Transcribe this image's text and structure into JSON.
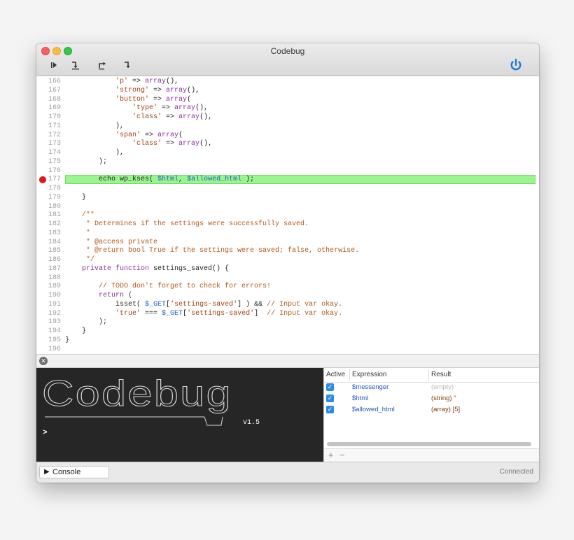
{
  "window": {
    "title": "Codebug"
  },
  "toolbar": {
    "buttons": [
      {
        "name": "continue-button",
        "icon": "continue-icon",
        "glyph": "⏵"
      },
      {
        "name": "step-over-button",
        "icon": "step-over-icon",
        "glyph": "↴"
      },
      {
        "name": "step-out-button",
        "icon": "step-out-icon",
        "glyph": "↱"
      },
      {
        "name": "step-into-button",
        "icon": "step-into-icon",
        "glyph": "↳"
      }
    ],
    "power_icon": "power-icon",
    "power_color": "#1f7bd8"
  },
  "editor": {
    "highlight_color": "#9af58f",
    "breakpoint_color": "#e4141b",
    "lines": [
      {
        "n": "166",
        "html": "            <span class=\"str\">'p'</span> => <span class=\"kw\">array</span>(),"
      },
      {
        "n": "167",
        "html": "            <span class=\"str\">'strong'</span> => <span class=\"kw\">array</span>(),"
      },
      {
        "n": "168",
        "html": "            <span class=\"str\">'button'</span> => <span class=\"kw\">array</span>("
      },
      {
        "n": "169",
        "html": "                <span class=\"str\">'type'</span> => <span class=\"kw\">array</span>(),"
      },
      {
        "n": "170",
        "html": "                <span class=\"str\">'class'</span> => <span class=\"kw\">array</span>(),"
      },
      {
        "n": "171",
        "html": "            ),"
      },
      {
        "n": "172",
        "html": "            <span class=\"str\">'span'</span> => <span class=\"kw\">array</span>("
      },
      {
        "n": "173",
        "html": "                <span class=\"str\">'class'</span> => <span class=\"kw\">array</span>(),"
      },
      {
        "n": "174",
        "html": "            ),"
      },
      {
        "n": "175",
        "html": "        );"
      },
      {
        "n": "176",
        "html": ""
      },
      {
        "n": "177",
        "html": "        echo wp_kses( <span class=\"var\">$html</span>, <span class=\"var\">$allowed_html</span> );",
        "highlight": true,
        "breakpoint": true
      },
      {
        "n": "178",
        "html": ""
      },
      {
        "n": "179",
        "html": "    }"
      },
      {
        "n": "180",
        "html": ""
      },
      {
        "n": "181",
        "html": "    <span class=\"cmt\">/**</span>"
      },
      {
        "n": "182",
        "html": "<span class=\"cmt\">     * Determines if the settings were successfully saved.</span>"
      },
      {
        "n": "183",
        "html": "<span class=\"cmt\">     *</span>"
      },
      {
        "n": "184",
        "html": "<span class=\"cmt\">     * @access private</span>"
      },
      {
        "n": "185",
        "html": "<span class=\"cmt\">     * @return bool True if the settings were saved; false, otherwise.</span>"
      },
      {
        "n": "186",
        "html": "<span class=\"cmt\">     */</span>"
      },
      {
        "n": "187",
        "html": "    <span class=\"kw\">private function</span> settings_saved() {"
      },
      {
        "n": "188",
        "html": ""
      },
      {
        "n": "189",
        "html": "        <span class=\"cmt\">// TODO don't forget to check for errors!</span>"
      },
      {
        "n": "190",
        "html": "        <span class=\"kw\">return</span> ("
      },
      {
        "n": "191",
        "html": "            isset( <span class=\"var\">$_GET</span>[<span class=\"str\">'settings-saved'</span>] ) && <span class=\"cmt\">// Input var okay.</span>"
      },
      {
        "n": "192",
        "html": "            <span class=\"str\">'true'</span> === <span class=\"var\">$_GET</span>[<span class=\"str\">'settings-saved'</span>]  <span class=\"cmt\">// Input var okay.</span>"
      },
      {
        "n": "193",
        "html": "        );"
      },
      {
        "n": "194",
        "html": "    }"
      },
      {
        "n": "195",
        "html": "}"
      },
      {
        "n": "196",
        "html": ""
      }
    ]
  },
  "console": {
    "banner_text": "Codebug",
    "version": "v1.5",
    "prompt": ">"
  },
  "watch": {
    "headers": {
      "active": "Active",
      "expression": "Expression",
      "result": "Result"
    },
    "rows": [
      {
        "expression": "$messenger",
        "result": "(empty)",
        "empty": true
      },
      {
        "expression": "$html",
        "result": "(string) \""
      },
      {
        "expression": "$allowed_html",
        "result": "(array) [5]"
      }
    ],
    "add_label": "+",
    "remove_label": "−"
  },
  "status": {
    "console_button": "Console",
    "connection": "Connected"
  }
}
